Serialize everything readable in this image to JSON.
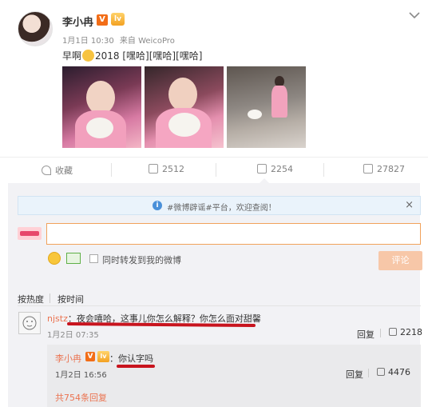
{
  "post": {
    "username": "李小冉",
    "v_badge": "V",
    "level_badge": "lv",
    "date": "1月1日 10:30",
    "source": "来自 WeicoPro",
    "text_before": "早啊",
    "text_after": "2018 [嘿哈][嘿哈][嘿哈]"
  },
  "actions": {
    "collect": "收藏",
    "repost": "2512",
    "comment": "2254",
    "like": "27827"
  },
  "notice": {
    "info": "i",
    "message": "#微博辟谣#平台，欢迎查阅！",
    "close": "×"
  },
  "composer": {
    "input_value": "",
    "checkbox_label": "同时转发到我的微博",
    "submit_label": "评论"
  },
  "sort": {
    "hot": "按热度",
    "time": "按时间"
  },
  "comment": {
    "user": "njstz",
    "text": "：夜会嘻哈，这事儿你怎么解释？你怎么面对甜馨",
    "time": "1月2日 07:35",
    "reply_label": "回复",
    "likes": "2218"
  },
  "reply": {
    "user": "李小冉",
    "v_badge": "V",
    "level_badge": "lv",
    "text": "：你认字吗",
    "time": "1月2日 16:56",
    "reply_label": "回复",
    "likes": "4476"
  },
  "more_replies": "共754条回复",
  "colors": {
    "accent": "#eb7350",
    "underline_annotation": "#c8141e",
    "input_border": "#f1a25b",
    "notice_bg": "#eaf3fb"
  }
}
